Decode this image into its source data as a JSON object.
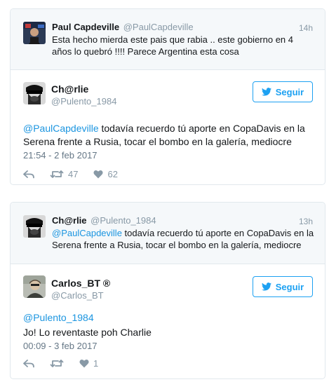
{
  "tweet1": {
    "parent": {
      "name": "Paul Capdeville",
      "handle": "@PaulCapdeville",
      "time": "14h",
      "text": "Esta hecho mierda este pais que rabia .. este gobierno en 4 años lo quebró !!!! Parece Argentina esta cosa"
    },
    "main": {
      "name": "Ch@rlie",
      "handle": "@Pulento_1984",
      "follow_label": "Seguir",
      "mention": "@PaulCapdeville",
      "text": " todavía recuerdo tú aporte en CopaDavis en la Serena frente a Rusia, tocar el bombo en la galería, mediocre",
      "date": "21:54 - 2 feb 2017",
      "retweets": "47",
      "likes": "62"
    }
  },
  "tweet2": {
    "parent": {
      "name": "Ch@rlie",
      "handle": "@Pulento_1984",
      "time": "13h",
      "mention": "@PaulCapdeville",
      "text": " todavía recuerdo tú aporte en CopaDavis en la Serena frente a Rusia, tocar el bombo en la galería, mediocre"
    },
    "main": {
      "name": "Carlos_BT ®",
      "handle": "@Carlos_BT",
      "follow_label": "Seguir",
      "mention": "@Pulento_1984",
      "text": "Jo! Lo reventaste poh Charlie",
      "date": "00:09 - 3 feb 2017",
      "likes": "1"
    }
  },
  "colors": {
    "accent": "#1da1f2",
    "link": "#1b95e0",
    "muted": "#8899a6",
    "border": "#e1e8ed",
    "parent_bg": "#f5f8fa"
  }
}
